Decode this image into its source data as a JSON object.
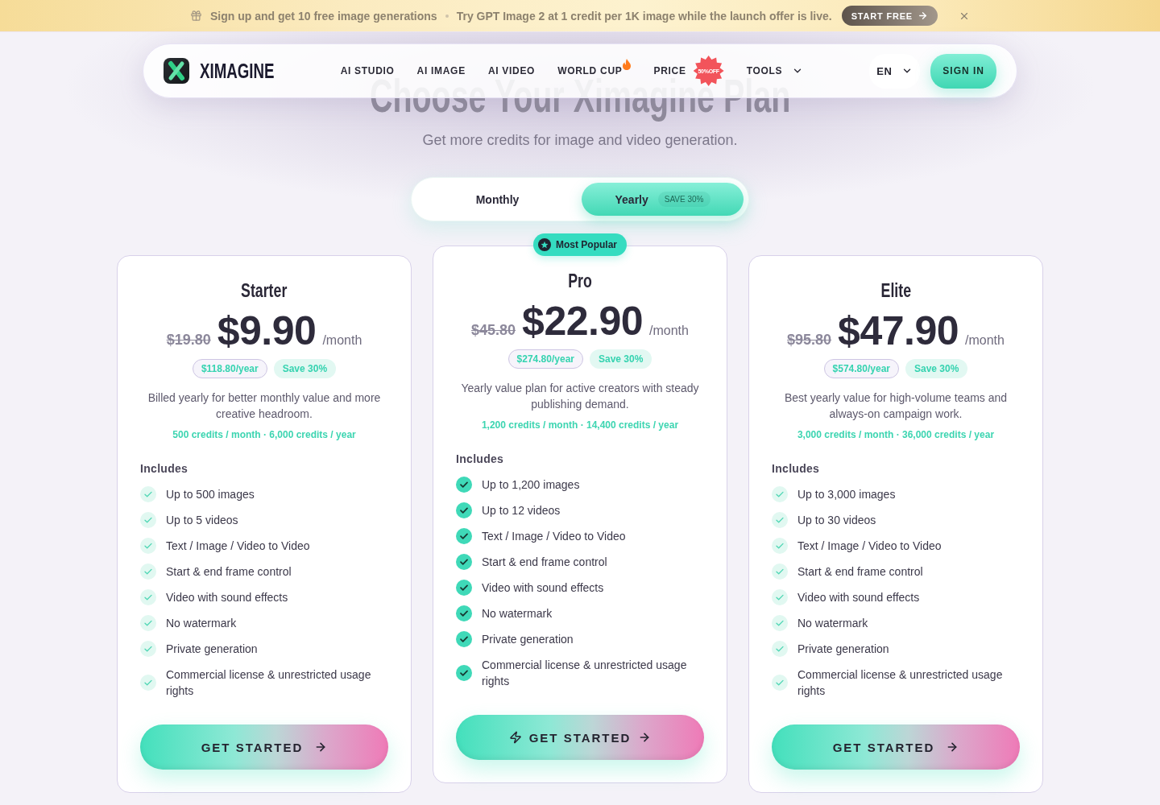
{
  "announcement": {
    "messages": [
      "Sign up and get 10 free image generations",
      "Try GPT Image 2 at 1 credit per 1K image while the launch offer is live."
    ],
    "cta": "START FREE"
  },
  "nav": {
    "brand": "XIMAGINE",
    "items": [
      {
        "label": "AI STUDIO",
        "kind": "link"
      },
      {
        "label": "AI IMAGE",
        "kind": "link"
      },
      {
        "label": "AI VIDEO",
        "kind": "link"
      },
      {
        "label": "WORLD CUP",
        "kind": "hot"
      },
      {
        "label": "PRICE",
        "kind": "promo",
        "badge": "50%OFF"
      },
      {
        "label": "TOOLS",
        "kind": "dropdown"
      }
    ],
    "language": "EN",
    "sign_in": "SIGN IN"
  },
  "hero": {
    "title": "Choose Your Ximagine Plan",
    "subtitle": "Get more credits for image and video generation."
  },
  "billing_toggle": {
    "options": [
      {
        "label": "Monthly",
        "selected": false
      },
      {
        "label": "Yearly",
        "selected": true,
        "badge": "SAVE 30%"
      }
    ]
  },
  "plans": [
    {
      "name": "Starter",
      "featured": false,
      "old_price": "$19.80",
      "price": "$9.90",
      "period": "/month",
      "yearly_total": "$118.80/year",
      "savings": "Save 30%",
      "description": "Billed yearly for better monthly value and more creative headroom.",
      "credits": "500 credits / month · 6,000 credits / year",
      "includes_label": "Includes",
      "features": [
        "Up to 500 images",
        "Up to 5 videos",
        "Text / Image / Video to Video",
        "Start & end frame control",
        "Video with sound effects",
        "No watermark",
        "Private generation",
        "Commercial license & unrestricted usage rights"
      ],
      "cta": "GET STARTED"
    },
    {
      "name": "Pro",
      "featured": true,
      "badge": "Most Popular",
      "old_price": "$45.80",
      "price": "$22.90",
      "period": "/month",
      "yearly_total": "$274.80/year",
      "savings": "Save 30%",
      "description": "Yearly value plan for active creators with steady publishing demand.",
      "credits": "1,200 credits / month · 14,400 credits / year",
      "includes_label": "Includes",
      "features": [
        "Up to 1,200 images",
        "Up to 12 videos",
        "Text / Image / Video to Video",
        "Start & end frame control",
        "Video with sound effects",
        "No watermark",
        "Private generation",
        "Commercial license & unrestricted usage rights"
      ],
      "cta": "GET STARTED"
    },
    {
      "name": "Elite",
      "featured": false,
      "old_price": "$95.80",
      "price": "$47.90",
      "period": "/month",
      "yearly_total": "$574.80/year",
      "savings": "Save 30%",
      "description": "Best yearly value for high-volume teams and always-on campaign work.",
      "credits": "3,000 credits / month · 36,000 credits / year",
      "includes_label": "Includes",
      "features": [
        "Up to 3,000 images",
        "Up to 30 videos",
        "Text / Image / Video to Video",
        "Start & end frame control",
        "Video with sound effects",
        "No watermark",
        "Private generation",
        "Commercial license & unrestricted usage rights"
      ],
      "cta": "GET STARTED"
    }
  ]
}
